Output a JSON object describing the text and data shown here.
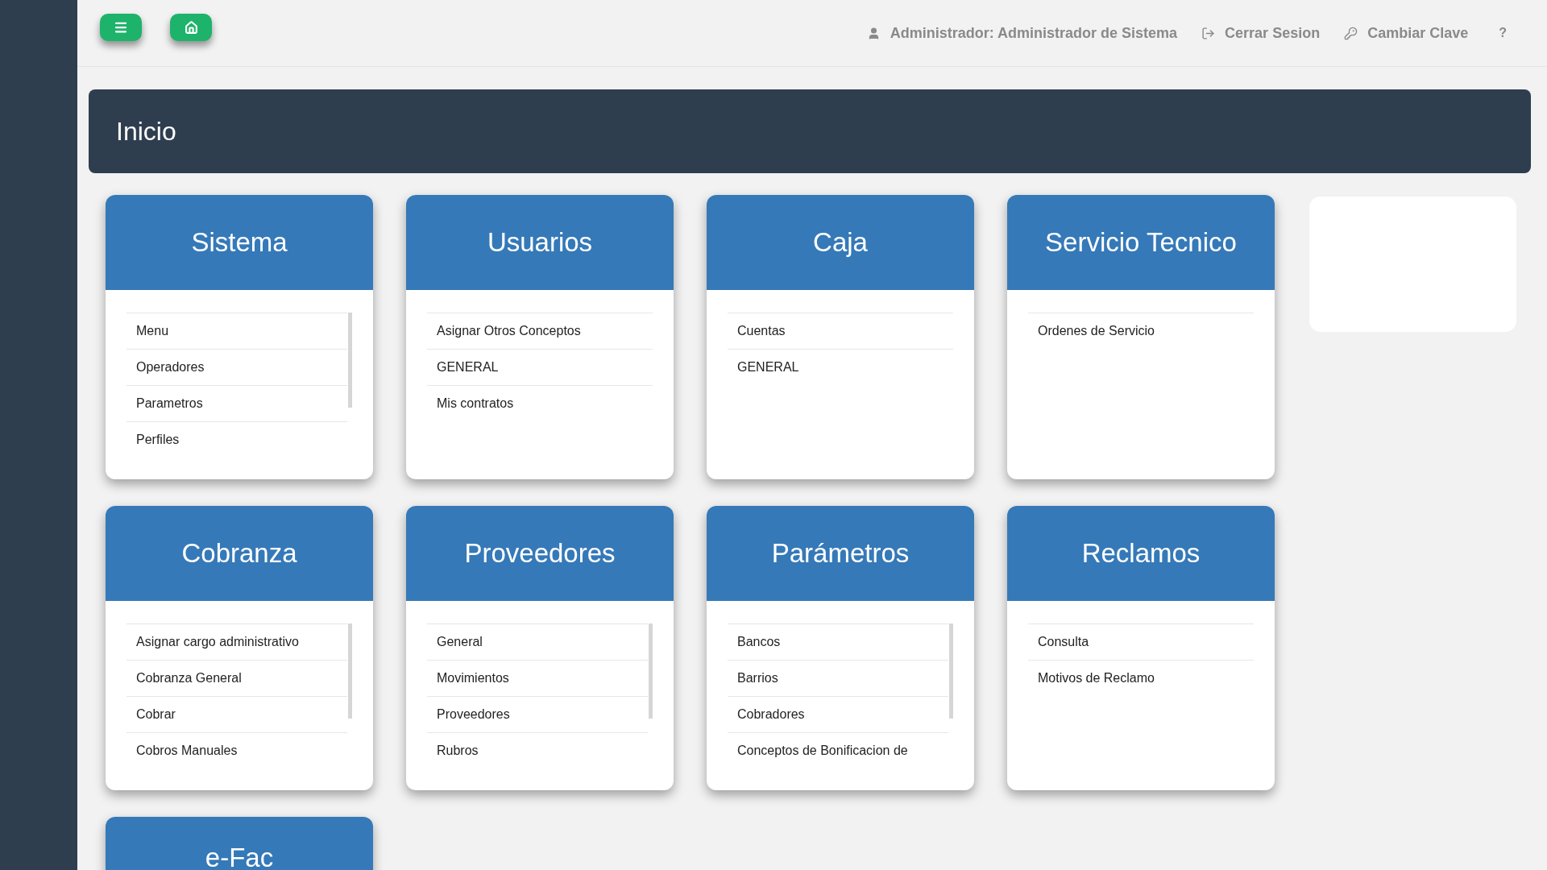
{
  "top_bar": {
    "user": "Administrador: Administrador de Sistema",
    "logout": "Cerrar Sesion",
    "change_password": "Cambiar Clave",
    "help": "?"
  },
  "page_title": "Inicio",
  "modules": [
    {
      "title": "Sistema",
      "scrollable": true,
      "items": [
        "Menu",
        "Operadores",
        "Parametros",
        "Perfiles"
      ]
    },
    {
      "title": "Usuarios",
      "scrollable": false,
      "items": [
        "Asignar Otros Conceptos",
        "GENERAL",
        "Mis contratos"
      ]
    },
    {
      "title": "Caja",
      "scrollable": false,
      "items": [
        "Cuentas",
        "GENERAL"
      ]
    },
    {
      "title": "Servicio Tecnico",
      "scrollable": false,
      "items": [
        "Ordenes de Servicio"
      ]
    },
    {
      "title": "Cobranza",
      "scrollable": true,
      "items": [
        "Asignar cargo administrativo",
        "Cobranza General",
        "Cobrar",
        "Cobros Manuales"
      ]
    },
    {
      "title": "Proveedores",
      "scrollable": true,
      "items": [
        "General",
        "Movimientos",
        "Proveedores",
        "Rubros"
      ]
    },
    {
      "title": "Parámetros",
      "scrollable": true,
      "items": [
        "Bancos",
        "Barrios",
        "Cobradores",
        "Conceptos de Bonificacion de"
      ]
    },
    {
      "title": "Reclamos",
      "scrollable": false,
      "items": [
        "Consulta",
        "Motivos de Reclamo"
      ]
    },
    {
      "title": "e-Fac"
    }
  ]
}
